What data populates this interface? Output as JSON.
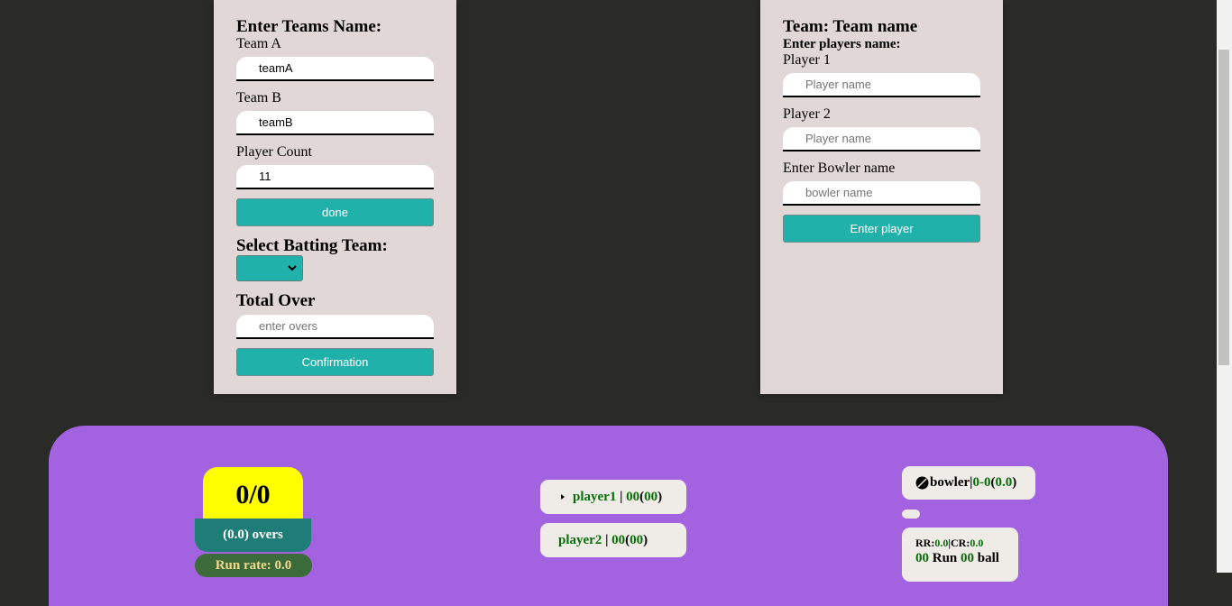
{
  "setup": {
    "heading": "Enter Teams Name:",
    "team_a_label": "Team A",
    "team_a_value": "teamA",
    "team_b_label": "Team B",
    "team_b_value": "teamB",
    "player_count_label": "Player Count",
    "player_count_value": "11",
    "done_label": "done",
    "batting_heading": "Select Batting Team:",
    "batting_selected": "",
    "total_over_heading": "Total Over",
    "overs_placeholder": "enter overs",
    "confirm_label": "Confirmation"
  },
  "players": {
    "team_heading": "Team: Team name",
    "players_heading": "Enter players name:",
    "player1_label": "Player 1",
    "player1_placeholder": "Player name",
    "player2_label": "Player 2",
    "player2_placeholder": "Player name",
    "bowler_label": "Enter Bowler name",
    "bowler_placeholder": "bowler name",
    "enter_player_label": "Enter player"
  },
  "scoreboard": {
    "score": "0/0",
    "overs": "(0.0) overs",
    "run_rate": "Run rate: 0.0",
    "striker": {
      "name": "player1",
      "sep": " | ",
      "runs": "00",
      "balls": "00"
    },
    "non_striker": {
      "name": "player2",
      "sep": " | ",
      "runs": "00",
      "balls": "00"
    },
    "bowler": {
      "name": "bowler",
      "figures": "0-0",
      "overs": "0.0"
    },
    "rr_label": "RR:",
    "rr_value": "0.0",
    "cr_label": "CR:",
    "cr_value": "0.0",
    "need_runs": "00",
    "run_word": "Run",
    "need_balls": "00",
    "ball_word": "ball"
  },
  "colors": {
    "accent": "#20b2aa",
    "board": "#a362e0",
    "panel": "#e1d7d6",
    "score_bg": "#ffff00",
    "value_green": "#0a6d0a"
  }
}
